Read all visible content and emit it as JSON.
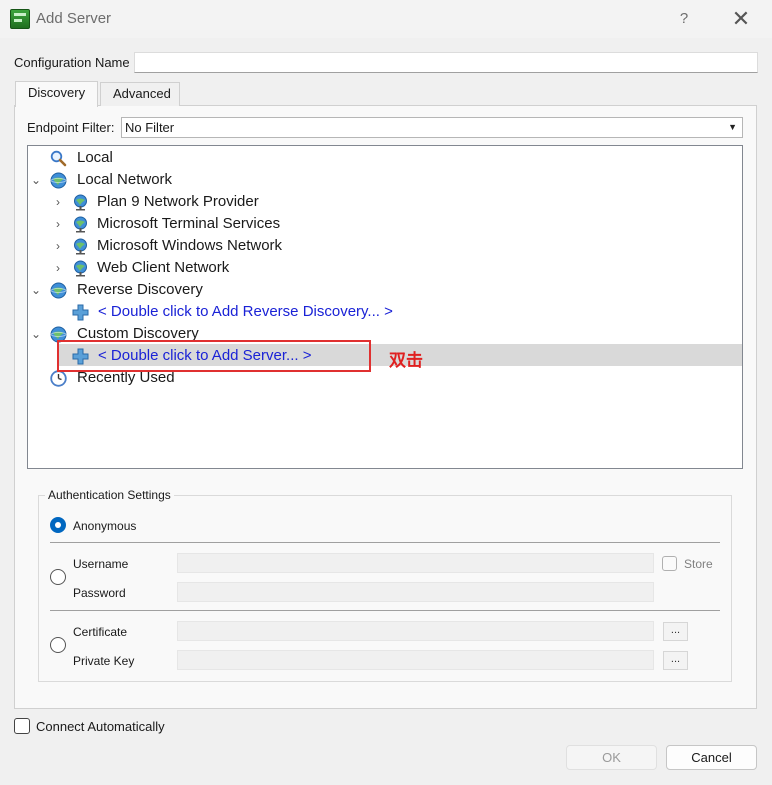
{
  "window": {
    "title": "Add Server",
    "help_glyph": "?",
    "close_glyph": "✕",
    "app_icon": "uaexpert-app-icon"
  },
  "configuration": {
    "label": "Configuration Name",
    "value": ""
  },
  "tabs": [
    {
      "label": "Discovery",
      "active": true
    },
    {
      "label": "Advanced",
      "active": false
    }
  ],
  "endpoint_filter": {
    "label": "Endpoint Filter:",
    "value": "No Filter"
  },
  "tree": {
    "local": "Local",
    "local_network": "Local Network",
    "plan9": "Plan 9 Network Provider",
    "ms_terminal": "Microsoft Terminal Services",
    "ms_windows": "Microsoft Windows Network",
    "web_client": "Web Client Network",
    "reverse_discovery": "Reverse Discovery",
    "add_reverse": "< Double click to Add Reverse Discovery... >",
    "custom_discovery": "Custom Discovery",
    "add_server": "< Double click to Add Server... >",
    "recently_used": "Recently Used"
  },
  "annotation": {
    "text": "双击",
    "color": "#e02020"
  },
  "auth": {
    "legend": "Authentication Settings",
    "anonymous": "Anonymous",
    "username": "Username",
    "password": "Password",
    "store": "Store",
    "certificate": "Certificate",
    "private_key": "Private Key",
    "browse": "...",
    "selected": "Anonymous"
  },
  "connect_automatically": {
    "label": "Connect Automatically",
    "checked": false
  },
  "buttons": {
    "ok": "OK",
    "cancel": "Cancel"
  },
  "colors": {
    "link": "#1a22d6",
    "accent": "#0067c0",
    "selection": "#d9d9d9"
  }
}
